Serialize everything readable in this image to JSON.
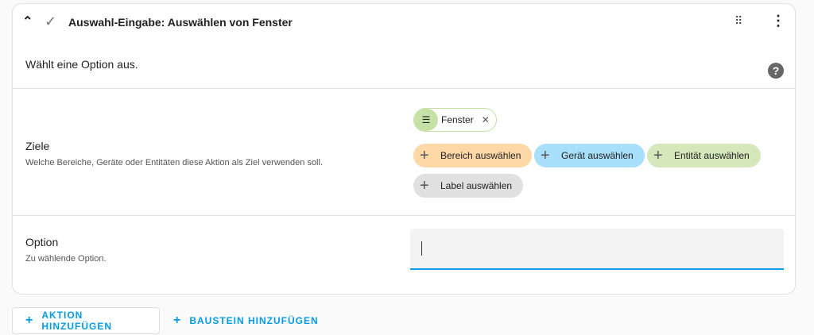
{
  "header": {
    "title": "Auswahl-Eingabe: Auswählen von Fenster",
    "description": "Wählt eine Option aus."
  },
  "targets": {
    "label": "Ziele",
    "description": "Welche Bereiche, Geräte oder Entitäten diese Aktion als Ziel verwenden soll.",
    "selected_chip": "Fenster",
    "buttons": [
      "Bereich auswählen",
      "Gerät auswählen",
      "Entität auswählen",
      "Label auswählen"
    ]
  },
  "option": {
    "label": "Option",
    "description": "Zu wählende Option.",
    "value": ""
  },
  "actions": {
    "add_action": "AKTION HINZUFÜGEN",
    "add_block": "BAUSTEIN HINZUFÜGEN"
  }
}
